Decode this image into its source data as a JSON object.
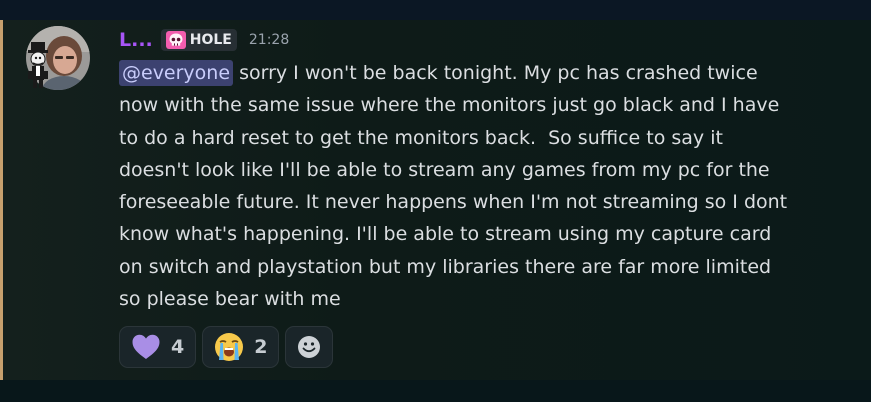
{
  "message": {
    "author": {
      "display_name": "L...",
      "tag_label": "HOLE",
      "tag_icon": "skull-icon",
      "name_color": "#a855f7"
    },
    "timestamp": "21:28",
    "mention": "@everyone",
    "text": " sorry I won't be back tonight. My pc has crashed twice\nnow with the same issue where the monitors just go black and I have\nto do a hard reset to get the monitors back.  So suffice to say it\ndoesn't look like I'll be able to stream any games from my pc for the\nforeseeable future. It never happens when I'm not streaming so I dont\nknow what's happening. I'll be able to stream using my capture card\non switch and playstation but my libraries there are far more limited\nso please bear with me",
    "reactions": [
      {
        "emoji": "purple-heart-icon",
        "count": "4"
      },
      {
        "emoji": "loudly-crying-face-icon",
        "count": "2"
      }
    ],
    "add_reaction_icon": "smiley-add-reaction-icon"
  },
  "colors": {
    "accent_bar": "#c7a06e",
    "mention_bg": "#3c4270",
    "text": "#dbdee1"
  }
}
